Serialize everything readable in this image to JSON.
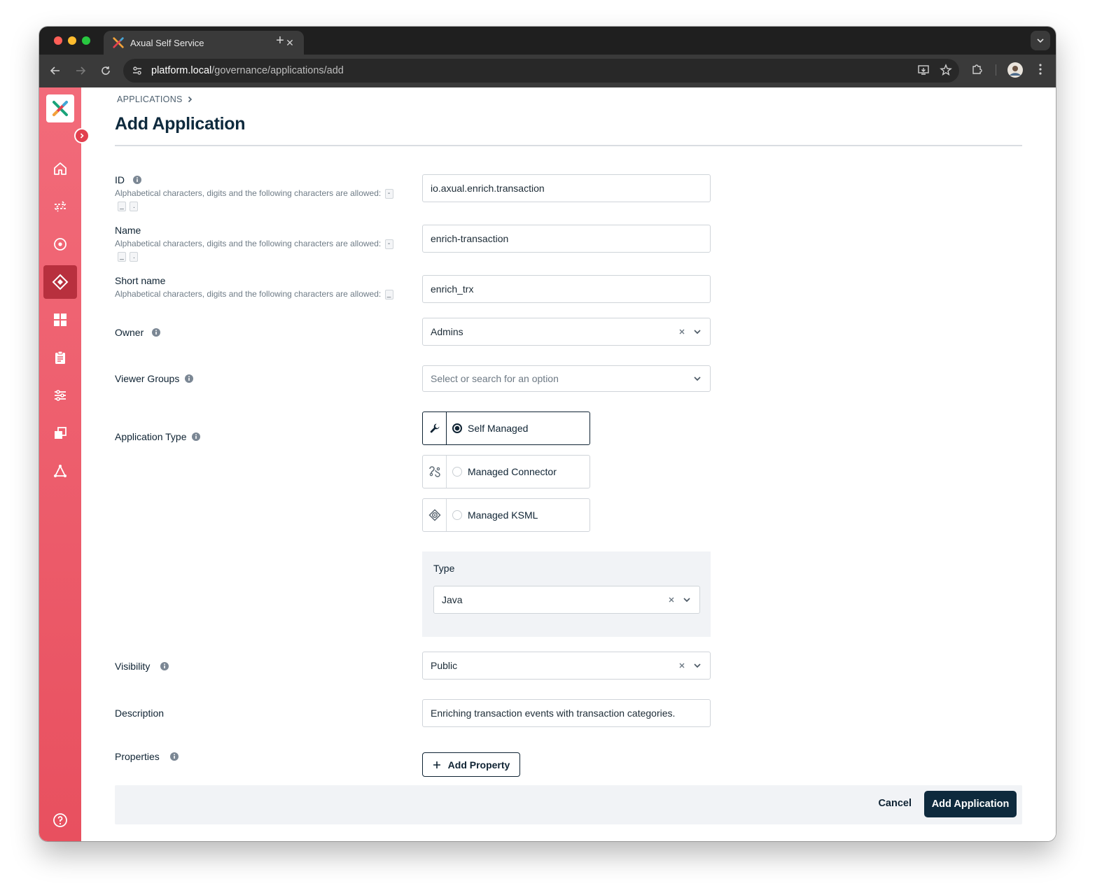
{
  "browser": {
    "tab_title": "Axual Self Service",
    "url_host": "platform.local",
    "url_path": "/governance/applications/add"
  },
  "breadcrumb": {
    "label": "APPLICATIONS"
  },
  "page": {
    "title": "Add Application"
  },
  "form": {
    "id": {
      "label": "ID",
      "hint": "Alphabetical characters, digits and the following characters are allowed:",
      "chips": [
        "-",
        "_",
        "."
      ],
      "value": "io.axual.enrich.transaction"
    },
    "name": {
      "label": "Name",
      "hint": "Alphabetical characters, digits and the following characters are allowed:",
      "chips": [
        "-",
        "_",
        "."
      ],
      "value": "enrich-transaction"
    },
    "short_name": {
      "label": "Short name",
      "hint": "Alphabetical characters, digits and the following characters are allowed:",
      "chips": [
        "_"
      ],
      "value": "enrich_trx"
    },
    "owner": {
      "label": "Owner",
      "value": "Admins"
    },
    "viewer_groups": {
      "label": "Viewer Groups",
      "placeholder": "Select or search for an option"
    },
    "application_type": {
      "label": "Application Type",
      "options": [
        {
          "label": "Self Managed",
          "icon": "wrench-icon",
          "selected": true
        },
        {
          "label": "Managed Connector",
          "icon": "connector-icon",
          "selected": false
        },
        {
          "label": "Managed KSML",
          "icon": "ksml-icon",
          "selected": false
        }
      ]
    },
    "type": {
      "label": "Type",
      "value": "Java"
    },
    "visibility": {
      "label": "Visibility",
      "value": "Public"
    },
    "description": {
      "label": "Description",
      "value": "Enriching transaction events with transaction categories."
    },
    "properties": {
      "label": "Properties",
      "add_label": "Add Property"
    }
  },
  "actions": {
    "cancel": "Cancel",
    "submit": "Add Application"
  },
  "colors": {
    "sidebar": "#ee5f6e",
    "primary": "#0e2a3d",
    "panel": "#f1f3f6"
  }
}
